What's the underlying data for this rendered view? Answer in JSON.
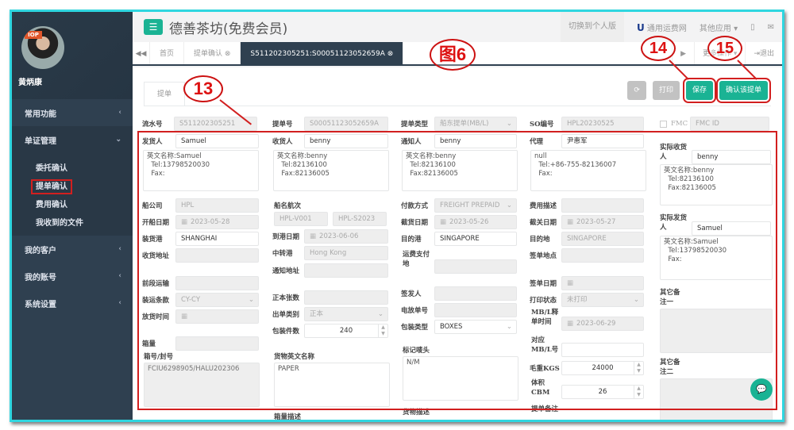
{
  "sidebar": {
    "user_name": "黄炳康",
    "avatar_logo": "IOP",
    "menu": [
      {
        "label": "常用功能",
        "icon": "chevron-left"
      },
      {
        "label": "单证管理",
        "icon": "chevron-down"
      },
      {
        "label": "我的客户",
        "icon": "chevron-left"
      },
      {
        "label": "我的账号",
        "icon": "chevron-left"
      },
      {
        "label": "系统设置",
        "icon": "chevron-left"
      }
    ],
    "submenu": [
      "委托确认",
      "提单确认",
      "费用确认",
      "我收到的文件"
    ],
    "active_submenu": "提单确认"
  },
  "topbar": {
    "menu_icon": "☰",
    "title": "德善茶坊(免费会员)",
    "switch_label": "切换到个人版",
    "brand_logo": "U",
    "brand_label": "通用运费网",
    "other_apps": "其他应用 ▾",
    "mobile_icon": "▯",
    "mail_icon": "✉"
  },
  "tabs": {
    "back_icon": "◀◀",
    "items": [
      {
        "label": "首页"
      },
      {
        "label": "提单确认 ⊗"
      },
      {
        "label": "S511202305251:S00051123052659A ⊗",
        "active": true
      }
    ],
    "forward_icon": "▶",
    "more_label": "更多操作 ▾",
    "logout_label": "⇥退出"
  },
  "form_tab": "提单",
  "actions": {
    "refresh_icon": "⟳",
    "print": "打印",
    "save": "保存",
    "confirm": "确认该提单"
  },
  "annotations": {
    "figure": "图6",
    "n13": "13",
    "n14": "14",
    "n15": "15"
  },
  "form": {
    "serial_no": {
      "label": "流水号",
      "value": "S511202305251"
    },
    "bl_no": {
      "label": "提单号",
      "value": "S00051123052659A"
    },
    "bl_type": {
      "label": "提单类型",
      "value": "船东提单(MB/L)"
    },
    "so_no": {
      "label": "SO编号",
      "value": "HPL20230525"
    },
    "fmc": {
      "label": "FMC",
      "placeholder": "FMC ID"
    },
    "shipper": {
      "label": "发货人",
      "value": "Samuel",
      "detail": "英文名称:Samuel\n  Tel:13798520030\n  Fax:"
    },
    "consignee": {
      "label": "收货人",
      "value": "benny",
      "detail": "英文名称:benny\n  Tel:82136100\n  Fax:82136005"
    },
    "notify": {
      "label": "通知人",
      "value": "benny",
      "detail": "英文名称:benny\n  Tel:82136100\n  Fax:82136005"
    },
    "agent": {
      "label": "代理",
      "value": "尹惠军",
      "detail": "null\n  Tel:+86-755-82136007\n  Fax:"
    },
    "actual_consignee": {
      "label": "实际收货人",
      "value": "benny",
      "detail": "英文名称:benny\n  Tel:82136100\n  Fax:82136005"
    },
    "actual_shipper": {
      "label": "实际发货人",
      "value": "Samuel",
      "detail": "英文名称:Samuel\n  Tel:13798520030\n  Fax:"
    },
    "carrier": {
      "label": "船公司",
      "value": "HPL"
    },
    "sail_date": {
      "label": "开船日期",
      "value": "2023-05-28"
    },
    "pol": {
      "label": "装货港",
      "value": "SHANGHAI"
    },
    "receipt_addr": {
      "label": "收货地址",
      "value": ""
    },
    "pre_carriage": {
      "label": "前段运输",
      "value": ""
    },
    "terms": {
      "label": "装运条款",
      "value": "CY-CY"
    },
    "release_time": {
      "label": "放货时间",
      "value": ""
    },
    "container_qty": {
      "label": "箱量",
      "value": ""
    },
    "container_seal": {
      "label": "箱号/封号",
      "value": "FCIU6298905/HALU202306"
    },
    "vessel_voyage": {
      "label": "船名航次",
      "vessel": "HPL-V001",
      "voyage": "HPL-S2023"
    },
    "arrival_date": {
      "label": "到港日期",
      "value": "2023-06-06"
    },
    "transit_port": {
      "label": "中转港",
      "value": "Hong Kong"
    },
    "notify_addr": {
      "label": "通知地址",
      "value": ""
    },
    "originals": {
      "label": "正本张数",
      "value": ""
    },
    "issue_type": {
      "label": "出单类别",
      "value": "正本"
    },
    "packages": {
      "label": "包装件数",
      "value": "240"
    },
    "goods_name": {
      "label": "货物英文名称",
      "value": "PAPER"
    },
    "container_desc": {
      "label": "箱量描述"
    },
    "payment": {
      "label": "付款方式",
      "value": "FREIGHT PREPAID"
    },
    "cutoff_date": {
      "label": "截货日期",
      "value": "2023-05-26"
    },
    "pod": {
      "label": "目的港",
      "value": "SINGAPORE"
    },
    "freight_pay_at": {
      "label": "运费支付地",
      "value": ""
    },
    "issuer": {
      "label": "签发人",
      "value": ""
    },
    "telex_no": {
      "label": "电放单号",
      "value": ""
    },
    "package_type": {
      "label": "包装类型",
      "value": "BOXES"
    },
    "marks": {
      "label": "标记唛头",
      "value": "N/M"
    },
    "goods_desc": {
      "label": "货物描述"
    },
    "fee_desc": {
      "label": "费用描述",
      "value": ""
    },
    "customs_cutoff": {
      "label": "截关日期",
      "value": "2023-05-27"
    },
    "destination": {
      "label": "目的地",
      "value": "SINGAPORE"
    },
    "sign_place": {
      "label": "签单地点",
      "value": ""
    },
    "sign_date": {
      "label": "签单日期",
      "value": ""
    },
    "print_status": {
      "label": "打印状态",
      "value": "未打印"
    },
    "mbl_release": {
      "label": "MB/L释单时间",
      "value": "2023-06-29"
    },
    "mbl_no": {
      "label": "对应MB/L号",
      "value": ""
    },
    "gross_weight": {
      "label": "毛重KGS",
      "value": "24000"
    },
    "volume": {
      "label": "体积CBM",
      "value": "26"
    },
    "bl_remark": {
      "label": "提单备注"
    },
    "other_remark1": {
      "label": "其它备注一",
      "value": ""
    },
    "other_remark2": {
      "label": "其它备注二",
      "value": ""
    }
  },
  "chat_icon": "💬"
}
